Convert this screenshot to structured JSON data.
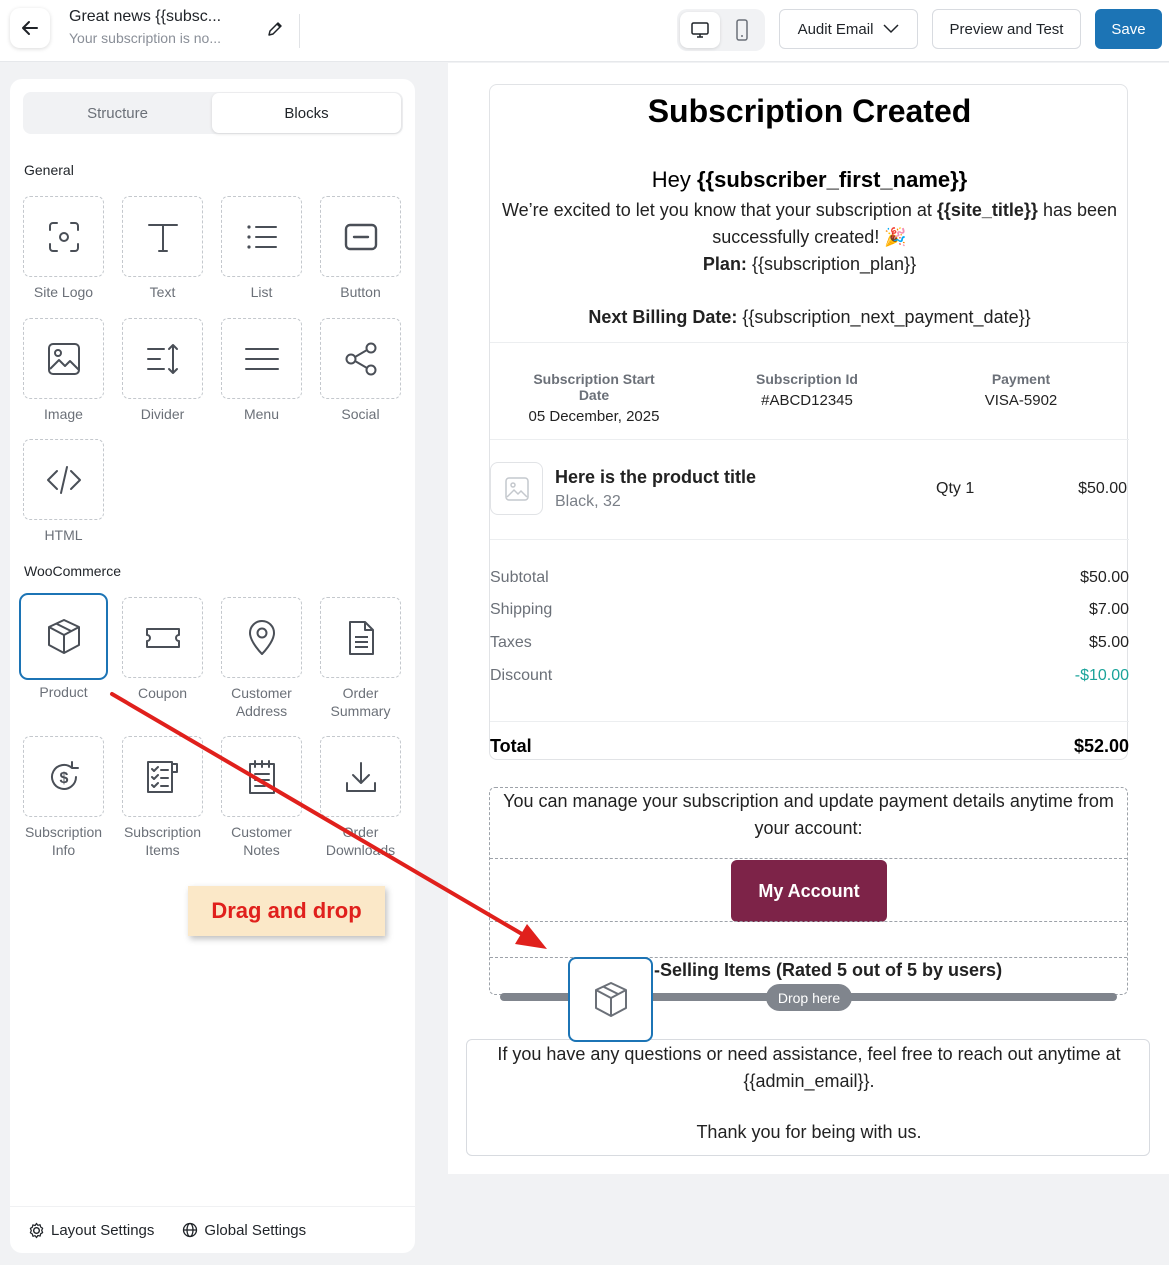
{
  "header": {
    "title": "Great news {{subsc...",
    "subtitle": "Your subscription is no...",
    "audit_label": "Audit Email",
    "preview_label": "Preview and Test",
    "save_label": "Save"
  },
  "sidebar": {
    "tabs": [
      "Structure",
      "Blocks"
    ],
    "general_label": "General",
    "general_blocks": [
      {
        "label": "Site Logo",
        "icon": "site-logo-icon"
      },
      {
        "label": "Text",
        "icon": "text-icon"
      },
      {
        "label": "List",
        "icon": "list-icon"
      },
      {
        "label": "Button",
        "icon": "button-icon"
      },
      {
        "label": "Image",
        "icon": "image-icon"
      },
      {
        "label": "Divider",
        "icon": "divider-icon"
      },
      {
        "label": "Menu",
        "icon": "menu-icon"
      },
      {
        "label": "Social",
        "icon": "share-icon"
      },
      {
        "label": "HTML",
        "icon": "code-icon"
      }
    ],
    "woo_label": "WooCommerce",
    "woo_blocks": [
      {
        "label": "Product",
        "icon": "box-icon"
      },
      {
        "label": "Coupon",
        "icon": "ticket-icon"
      },
      {
        "label": "Customer Address",
        "icon": "location-pin-icon"
      },
      {
        "label": "Order Summary",
        "icon": "document-icon"
      },
      {
        "label": "Subscription Info",
        "icon": "dollar-refresh-icon"
      },
      {
        "label": "Subscription Items",
        "icon": "checklist-icon"
      },
      {
        "label": "Customer Notes",
        "icon": "notepad-icon"
      },
      {
        "label": "Order Downloads",
        "icon": "download-icon"
      }
    ],
    "layout_settings": "Layout Settings",
    "global_settings": "Global Settings"
  },
  "email": {
    "title": "Subscription Created",
    "hey": "Hey ",
    "hey_var": "{{subscriber_first_name}}",
    "body_pre": "We’re excited to let you know that your subscription at ",
    "site_var": "{{site_title}}",
    "body_post": " has been successfully created! 🎉",
    "plan_label": "Plan:",
    "plan_value": " {{subscription_plan}}",
    "billing_label": "Next Billing Date:",
    "billing_value": " {{subscription_next_payment_date}}",
    "meta": [
      {
        "head": "Subscription Start Date",
        "value": "05 December, 2025"
      },
      {
        "head": "Subscription Id",
        "value": "#ABCD12345"
      },
      {
        "head": "Payment",
        "value": "VISA-5902"
      }
    ],
    "product": {
      "title": "Here is the product title",
      "variant": "Black, 32",
      "qty": "Qty 1",
      "price": "$50.00"
    },
    "summary": [
      {
        "label": "Subtotal",
        "value": "$50.00"
      },
      {
        "label": "Shipping",
        "value": "$7.00"
      },
      {
        "label": "Taxes",
        "value": "$5.00"
      },
      {
        "label": "Discount",
        "value": "-$10.00"
      }
    ],
    "total_label": "Total",
    "total_value": "$52.00",
    "manage_text": "You can manage your subscription and update payment details anytime from your account:",
    "account_button": "My Account",
    "selling_text": "-Selling Items (Rated 5 out of 5 by users)",
    "drop_here": "Drop here",
    "footer_text": "If you have any questions or need assistance, feel free to reach out anytime at {{admin_email}}.",
    "footer_thanks": "Thank you for being with us."
  },
  "annotation": {
    "text": "Drag and drop"
  },
  "colors": {
    "accent": "#1c74b5",
    "account_button": "#7d2348",
    "discount": "#1aa39a",
    "annotation_text": "#e0201c",
    "annotation_bg": "#fbe8c8"
  }
}
